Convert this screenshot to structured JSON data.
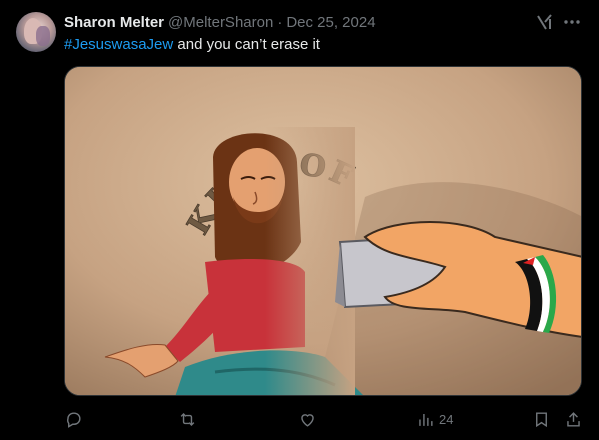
{
  "tweet": {
    "display_name": "Sharon Melter",
    "handle": "@MelterSharon",
    "separator": "·",
    "date": "Dec 25, 2024",
    "hashtag": "#JesuswasaJew",
    "text_rest": " and you can’t erase it"
  },
  "media": {
    "painted_text": "KING OF THE JEWS"
  },
  "actions": {
    "reply_icon": "reply-icon",
    "retweet_icon": "retweet-icon",
    "like_icon": "like-icon",
    "views_icon": "views-icon",
    "views_count": "24",
    "bookmark_icon": "bookmark-icon",
    "share_icon": "share-icon"
  },
  "colors": {
    "background": "#000000",
    "text": "#e7e9ea",
    "muted": "#71767b",
    "accent": "#1d9bf0"
  }
}
